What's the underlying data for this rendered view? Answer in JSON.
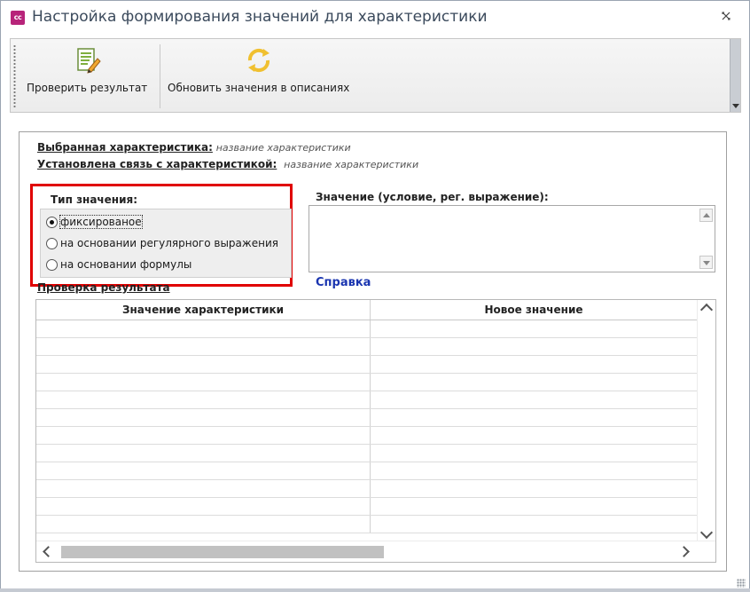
{
  "window": {
    "title": "Настройка формирования значений для характеристики",
    "icon_text": "cc"
  },
  "toolbar": {
    "check_result_label": "Проверить результат",
    "update_values_label": "Обновить значения в описаниях"
  },
  "info": {
    "selected_key": "Выбранная характеристика:",
    "selected_value": "название характеристики",
    "linked_key": "Установлена связь с характеристикой:",
    "linked_value": "название характеристики"
  },
  "value_type": {
    "title": "Тип значения:",
    "options": [
      {
        "label": "фиксированое",
        "checked": true
      },
      {
        "label": "на основании регулярного выражения",
        "checked": false
      },
      {
        "label": "на основании формулы",
        "checked": false
      }
    ]
  },
  "value_field": {
    "label": "Значение (условие, рег. выражение):",
    "value": ""
  },
  "help_link": "Справка",
  "check_section_label": "Проверка результата",
  "grid": {
    "columns": [
      "Значение характеристики",
      "Новое значение"
    ],
    "rows": [
      [
        "",
        ""
      ],
      [
        "",
        ""
      ],
      [
        "",
        ""
      ],
      [
        "",
        ""
      ],
      [
        "",
        ""
      ],
      [
        "",
        ""
      ],
      [
        "",
        ""
      ],
      [
        "",
        ""
      ],
      [
        "",
        ""
      ],
      [
        "",
        ""
      ],
      [
        "",
        ""
      ],
      [
        "",
        ""
      ]
    ]
  },
  "colors": {
    "highlight_border": "#e00000",
    "link": "#1a35b0",
    "app_icon": "#b7247a"
  }
}
